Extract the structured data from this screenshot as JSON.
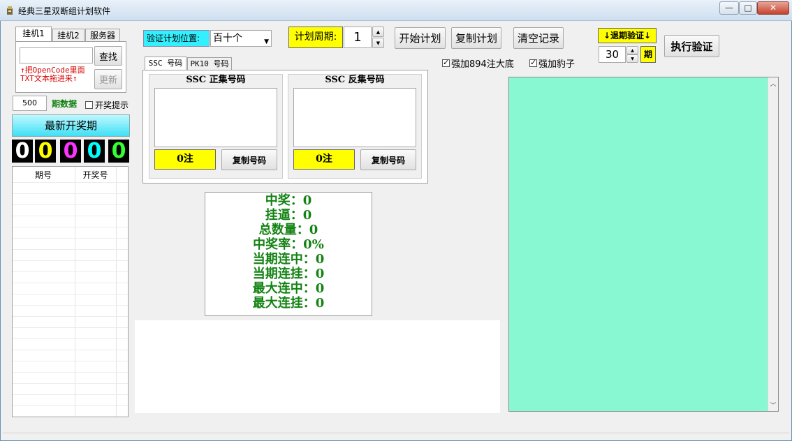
{
  "window": {
    "title": "经典三星双断组计划软件"
  },
  "left_tabs": [
    "挂机1",
    "挂机2",
    "服务器"
  ],
  "search_button": "查找",
  "update_button": "更新",
  "hint_lines": [
    "↑把OpenCode里面",
    "TXT文本拖进来↑"
  ],
  "period_count": {
    "value": "500",
    "label": "期数据"
  },
  "draw_alert_label": "开奖提示",
  "latest_period_button": "最新开奖期",
  "digits": [
    "0",
    "0",
    "0",
    "0",
    "0"
  ],
  "digit_colors": [
    "#ffffff",
    "#ffff00",
    "#ff33ff",
    "#00ffff",
    "#33ff33"
  ],
  "history_table": {
    "headers": [
      "期号",
      "开奖号"
    ]
  },
  "position": {
    "label": "验证计划位置:",
    "value": "百十个"
  },
  "plan_cycle": {
    "label": "计划周期:",
    "value": "1"
  },
  "top_buttons": [
    "开始计划",
    "复制计划",
    "清空记录"
  ],
  "backtest": {
    "label": "↓退期验证↓",
    "value": "30",
    "unit": "期",
    "run_button": "执行验证"
  },
  "checkboxes": [
    {
      "label": "强加894注大底",
      "checked": true
    },
    {
      "label": "强加豹子",
      "checked": true
    }
  ],
  "mid_tabs": [
    "SSC 号码",
    "PK10 号码"
  ],
  "groups": [
    {
      "title": "SSC 正集号码",
      "count": "0注",
      "copy": "复制号码"
    },
    {
      "title": "SSC 反集号码",
      "count": "0注",
      "copy": "复制号码"
    }
  ],
  "stats": [
    "中奖：0",
    "挂逼：0",
    "总数量：0",
    "中奖率：0%",
    "当期连中：0",
    "当期连挂：0",
    "最大连中：0",
    "最大连挂：0"
  ],
  "colors": {
    "accent_yellow": "#ffff00",
    "cyan": "#33f0ff",
    "result_area": "#88f8d3",
    "stats_green": "#128212"
  }
}
